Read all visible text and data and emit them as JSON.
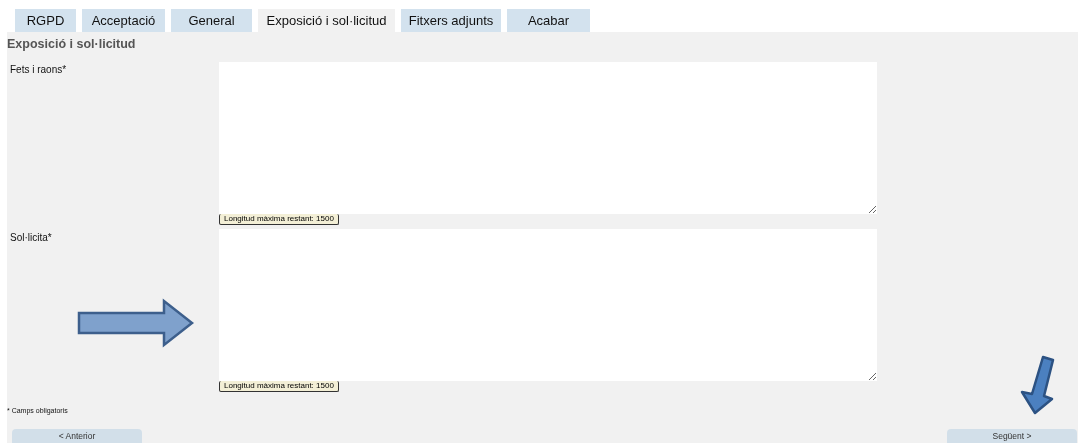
{
  "tabs": [
    {
      "label": "RGPD",
      "selected": false
    },
    {
      "label": "Acceptació",
      "selected": false
    },
    {
      "label": "General",
      "selected": false
    },
    {
      "label": "Exposició i sol·licitud",
      "selected": true
    },
    {
      "label": "Fitxers adjunts",
      "selected": false
    },
    {
      "label": "Acabar",
      "selected": false
    }
  ],
  "section_title": "Exposició i sol·licitud",
  "fields": [
    {
      "label": "Fets i raons*",
      "counter": "Longitud màxima restant: 1500"
    },
    {
      "label": "Sol·licita*",
      "counter": "Longitud màxima restant: 1500"
    }
  ],
  "footnote": "* Camps obligatoris",
  "buttons": {
    "previous": "< Anterior",
    "next": "Següent >"
  }
}
